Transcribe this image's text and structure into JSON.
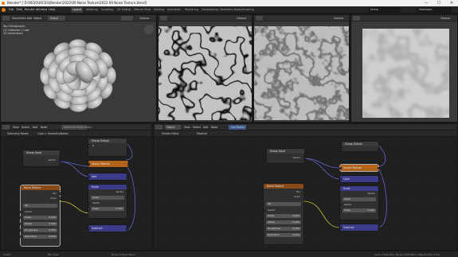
{
  "window": {
    "title": "Blender* [ D:\\RESOURCES\\Blender\\2022\\09 Noise Texture\\2022-09 Noise Texture.blend]",
    "minimize": "—",
    "maximize": "☐",
    "close": "✕"
  },
  "menu": {
    "items": [
      "File",
      "Edit",
      "Render",
      "Window",
      "Help"
    ],
    "workspaces": [
      "Layout",
      "Modeling",
      "Sculpting",
      "UV Editing",
      "Texture Paint",
      "Shading",
      "Animation",
      "Rendering",
      "Compositing",
      "Geometry Nodes",
      "Scripting"
    ],
    "active_workspace": "Layout",
    "scene": "Scene",
    "view_layer": "ViewLayer"
  },
  "viewport3d": {
    "mode": "Object Mode",
    "view": "View",
    "select": "Select",
    "add": "Add",
    "object": "Object",
    "global": "Global",
    "options": "Options",
    "info_lines": [
      "Top Orthographic",
      "(1) Collection | Cube",
      "10 Centimeters"
    ]
  },
  "image_viewports": {
    "options": "Options"
  },
  "node_editor_left": {
    "editor": "Geometry Node Editor",
    "menus": [
      "View",
      "Select",
      "Add",
      "Node"
    ],
    "tree_name": "Geometry Nodes",
    "breadcrumb": "Cube  >  GeometryNodes",
    "nodes": {
      "group_input": {
        "title": "Group Input",
        "out": "Vector"
      },
      "group_output": {
        "title": "Group Output",
        "rows": [
          "Vector",
          "Z"
        ]
      },
      "noise": {
        "title": "Noise Texture",
        "outputs": [
          "Fac",
          "Color"
        ],
        "dim": "3D",
        "input_label": "Vector",
        "fields": [
          {
            "label": "Scale",
            "value": "5.000"
          },
          {
            "label": "Detail",
            "value": "2.000"
          },
          {
            "label": "Roughness",
            "value": "0.500"
          },
          {
            "label": "Distortion",
            "value": "0.000"
          }
        ]
      },
      "set_position": {
        "title": "Vector Texture"
      },
      "add1": {
        "title": "Add"
      },
      "scale": {
        "title": "Scale",
        "out": "Vector",
        "op": "Scale",
        "in_label": "Vector",
        "field": {
          "label": "Scale",
          "value": "0.500"
        }
      },
      "subtract": {
        "title": "Subtract"
      }
    }
  },
  "node_editor_right": {
    "editor": "Shader Editor",
    "object": "Object",
    "menus": [
      "View",
      "Select",
      "Add",
      "Node"
    ],
    "material": "Material",
    "slot": "Use Nodes",
    "nodes": {
      "group_input": {
        "title": "Group Input",
        "out": "Vector"
      },
      "group_output": {
        "title": "Group Output"
      },
      "noise": {
        "title": "Noise Texture",
        "outputs": [
          "Fac",
          "Color"
        ],
        "dim": "3D",
        "input_label": "Vector",
        "fields": [
          {
            "label": "Scale",
            "value": "5.000"
          },
          {
            "label": "Detail",
            "value": "2.000"
          },
          {
            "label": "Roughness",
            "value": "0.500"
          },
          {
            "label": "Distortion",
            "value": "0.000"
          }
        ]
      },
      "orange": {
        "title": "Vector Texture"
      },
      "blue1": {
        "title": "Color"
      },
      "scale": {
        "title": "Scale",
        "out": "Vector",
        "op": "Scale",
        "in_label": "Vector",
        "field": {
          "label": "Scale",
          "value": "0.500"
        }
      },
      "subtract": {
        "title": "Subtract"
      }
    }
  },
  "status": {
    "left": "Select",
    "mid": "Pan View",
    "right_items": [
      "Node Context Menu"
    ],
    "version": "Verts 1,544,026 | Faces 1,543,981 | Objects 0/4 | 3.3.0"
  }
}
